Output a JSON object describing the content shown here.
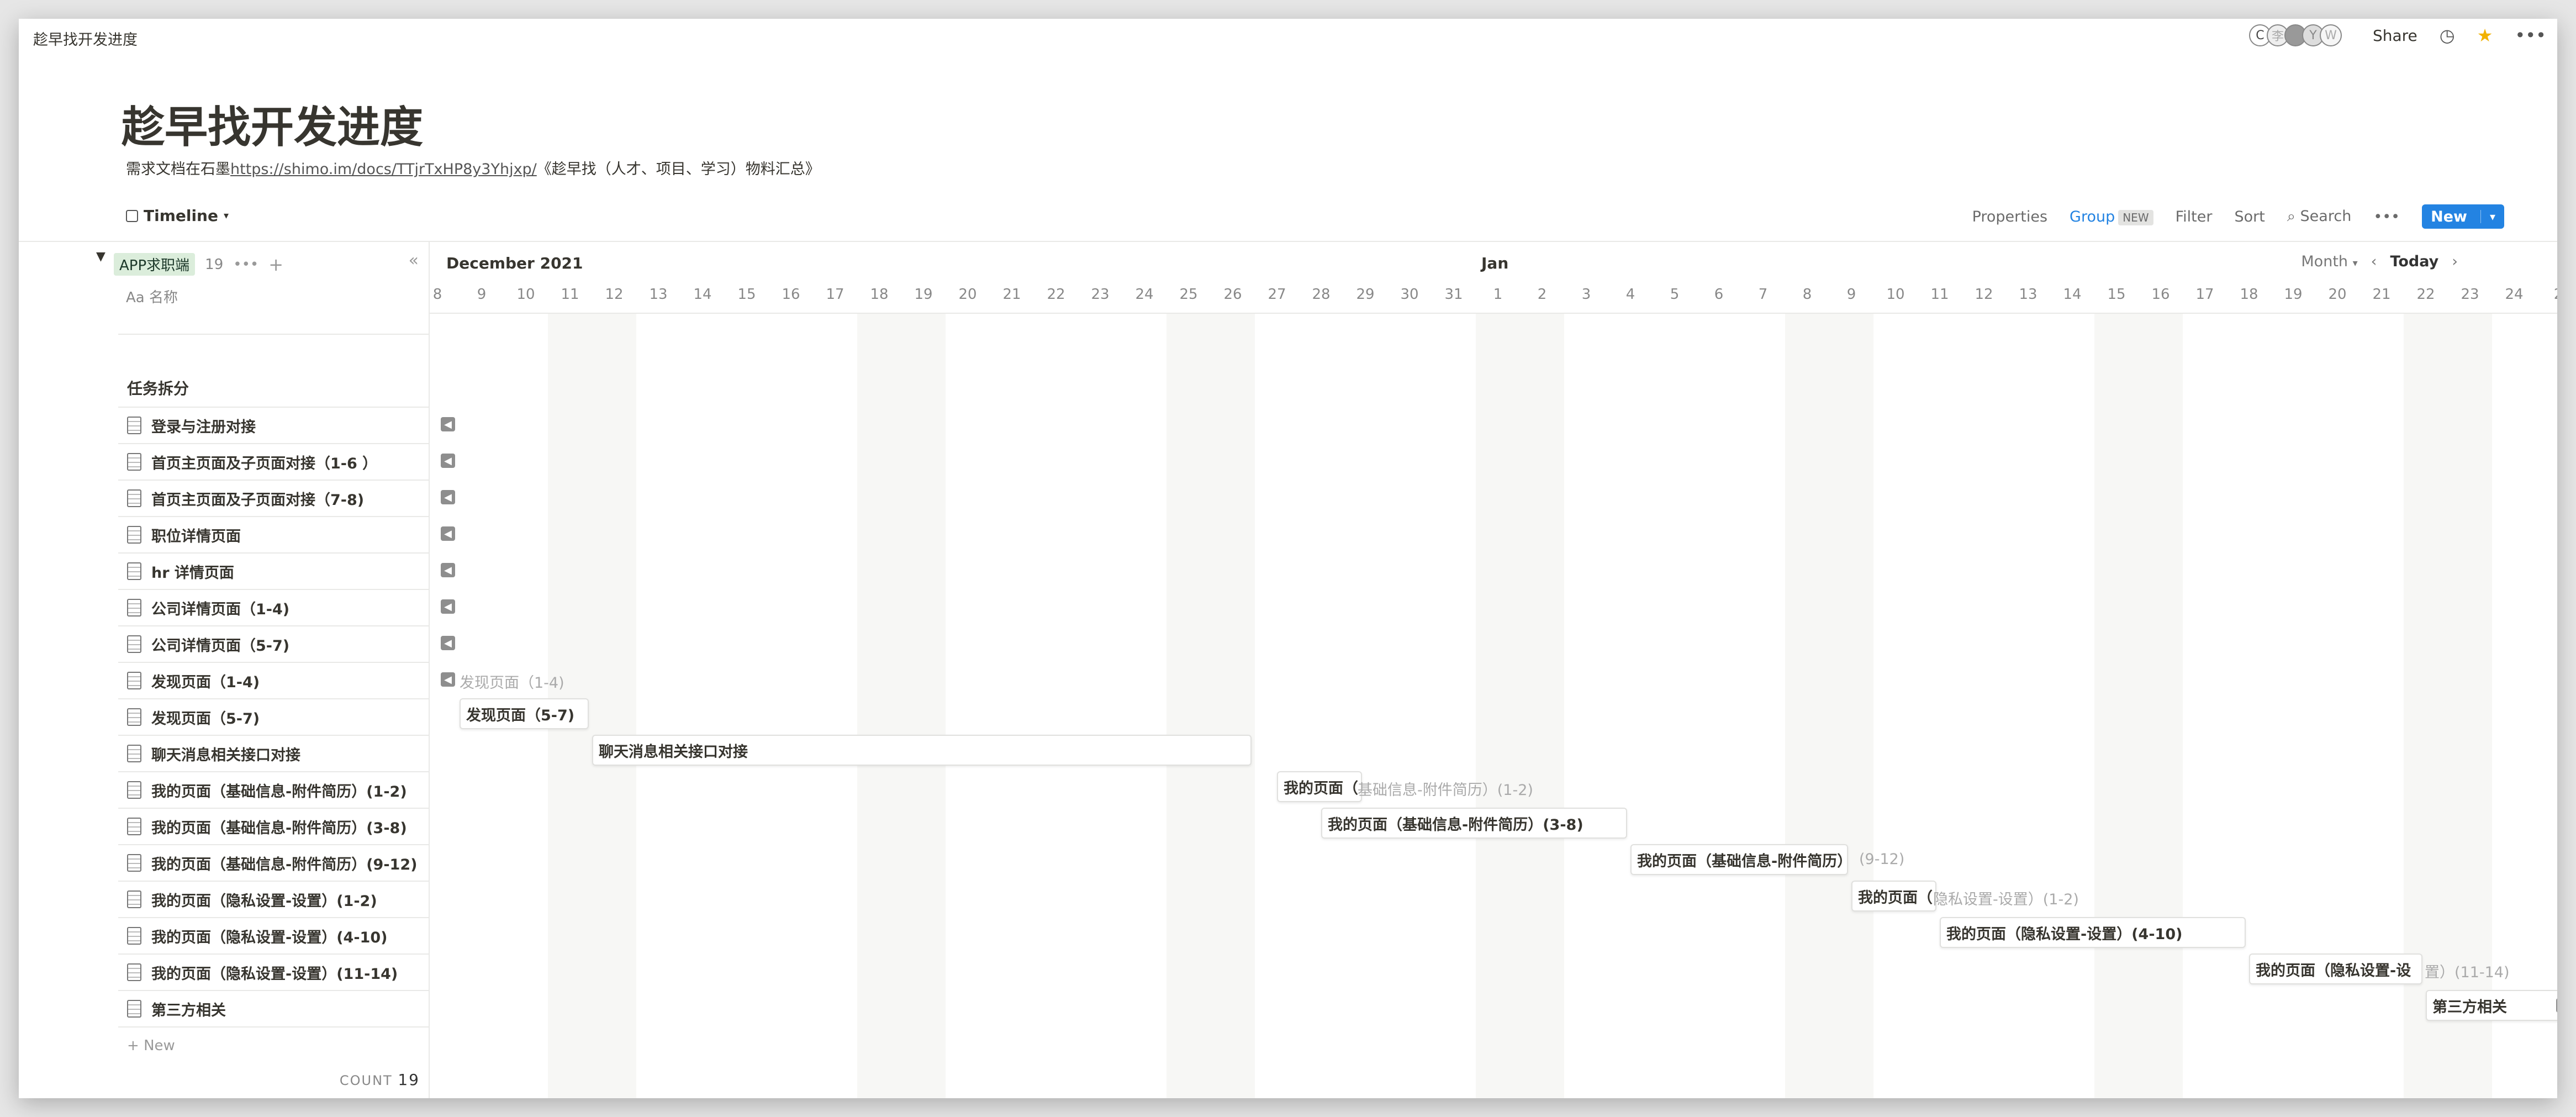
{
  "breadcrumb": "趁早找开发进度",
  "topbar": {
    "avatars": [
      "C",
      "李",
      "",
      "Y",
      "W"
    ],
    "share_label": "Share"
  },
  "page": {
    "title": "趁早找开发进度",
    "desc_prefix": "需求文档在石墨",
    "desc_link": "https://shimo.im/docs/TTjrTxHP8y3Yhjxp/",
    "desc_suffix": "《趁早找（人才、项目、学习）物料汇总》"
  },
  "view": {
    "label": "Timeline"
  },
  "toolbar": {
    "properties": "Properties",
    "group": "Group",
    "group_badge": "NEW",
    "filter": "Filter",
    "sort": "Sort",
    "search": "Search",
    "new_label": "New"
  },
  "group": {
    "name": "APP求职端",
    "count": "19"
  },
  "column_header": "名称",
  "section_label": "任务拆分",
  "rows": [
    "登录与注册对接",
    "首页主页面及子页面对接（1-6 ）",
    "首页主页面及子页面对接（7-8)",
    "职位详情页面",
    "hr 详情页面",
    "公司详情页面（1-4)",
    "公司详情页面（5-7)",
    "发现页面（1-4)",
    "发现页面（5-7)",
    "聊天消息相关接口对接",
    "我的页面（基础信息-附件简历）(1-2)",
    "我的页面（基础信息-附件简历）(3-8)",
    "我的页面（基础信息-附件简历）(9-12)",
    "我的页面（隐私设置-设置）(1-2)",
    "我的页面（隐私设置-设置）(4-10)",
    "我的页面（隐私设置-设置）(11-14)",
    "第三方相关"
  ],
  "new_row_label": "New",
  "count_label": "COUNT",
  "count_value": "19",
  "timeline": {
    "month_left": "December 2021",
    "month_mid": "Jan",
    "scale": "Month",
    "today": "Today",
    "days": [
      "8",
      "9",
      "10",
      "11",
      "12",
      "13",
      "14",
      "15",
      "16",
      "17",
      "18",
      "19",
      "20",
      "21",
      "22",
      "23",
      "24",
      "25",
      "26",
      "27",
      "28",
      "29",
      "30",
      "31",
      "1",
      "2",
      "3",
      "4",
      "5",
      "6",
      "7",
      "8",
      "9",
      "10",
      "11",
      "12",
      "13",
      "14",
      "15",
      "16",
      "17",
      "18",
      "19",
      "20",
      "21",
      "22",
      "23",
      "24",
      "2"
    ],
    "bars": {
      "b7_ghost": "发现页面（1-4)",
      "b8": "发现页面（5-7)",
      "b9": "聊天消息相关接口对接",
      "b10": "我的页面（",
      "b10_ghost": "基础信息-附件简历）(1-2)",
      "b11": "我的页面（基础信息-附件简历）(3-8)",
      "b12": "我的页面（基础信息-附件简历）",
      "b12_ghost": "(9-12)",
      "b13": "我的页面（",
      "b13_ghost": "隐私设置-设置）(1-2)",
      "b14": "我的页面（隐私设置-设置）(4-10)",
      "b15": "我的页面（隐私设置-设",
      "b15_ghost": "置）(11-14)",
      "b16": "第三方相关"
    }
  }
}
